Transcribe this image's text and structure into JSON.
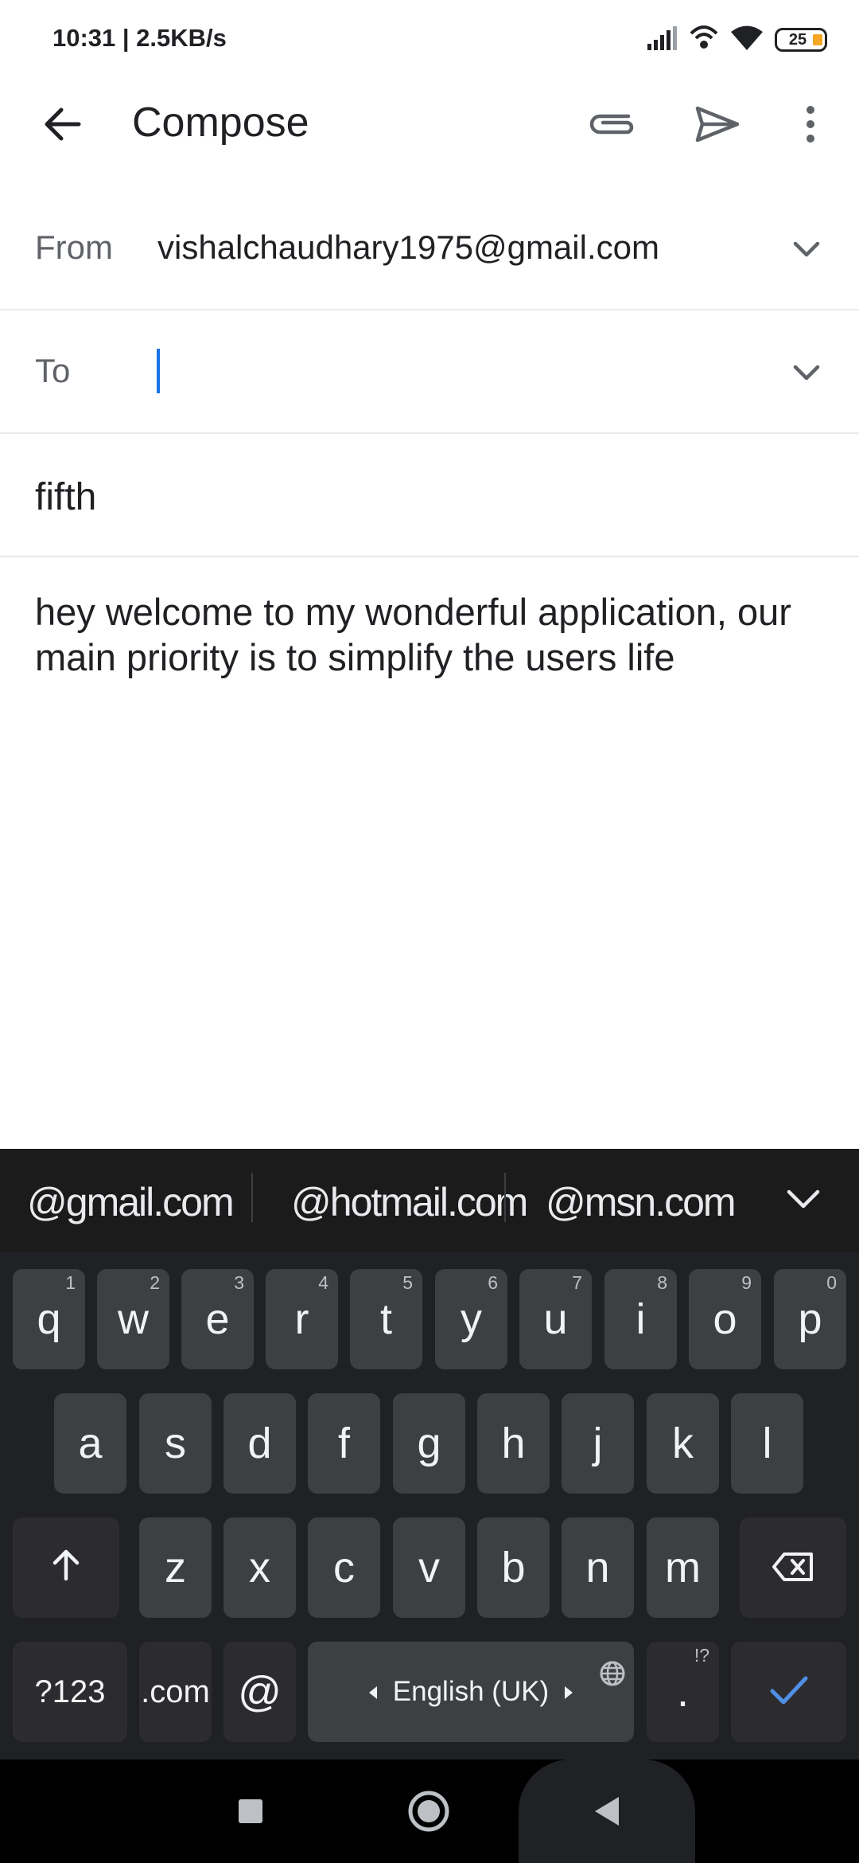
{
  "status_bar": {
    "time": "10:31 | 2.5KB/s",
    "battery": "25",
    "icons": [
      "signal-icon",
      "hotspot-icon",
      "wifi-icon",
      "battery-icon"
    ]
  },
  "app_bar": {
    "title": "Compose",
    "icons": [
      "back-arrow-icon",
      "paperclip-icon",
      "send-icon",
      "more-vert-icon"
    ]
  },
  "form": {
    "from_label": "From",
    "from_value": "vishalchaudhary1975@gmail.com",
    "to_label": "To",
    "to_value": "",
    "subject": "fifth",
    "body": "hey welcome to my wonderful application, our main priority is to simplify the users life"
  },
  "keyboard": {
    "suggestions": [
      "@gmail.com",
      "@hotmail.com",
      "@msn.com"
    ],
    "row1": [
      {
        "key": "q",
        "hint": "1"
      },
      {
        "key": "w",
        "hint": "2"
      },
      {
        "key": "e",
        "hint": "3"
      },
      {
        "key": "r",
        "hint": "4"
      },
      {
        "key": "t",
        "hint": "5"
      },
      {
        "key": "y",
        "hint": "6"
      },
      {
        "key": "u",
        "hint": "7"
      },
      {
        "key": "i",
        "hint": "8"
      },
      {
        "key": "o",
        "hint": "9"
      },
      {
        "key": "p",
        "hint": "0"
      }
    ],
    "row2": [
      "a",
      "s",
      "d",
      "f",
      "g",
      "h",
      "j",
      "k",
      "l"
    ],
    "row3": [
      "z",
      "x",
      "c",
      "v",
      "b",
      "n",
      "m"
    ],
    "symbols_key": "?123",
    "dotcom_key": ".com",
    "at_key": "@",
    "space_label": "English (UK)",
    "period_key": ".",
    "period_hint": "!?",
    "accent_color": "#8ab4f8"
  },
  "nav_bar": {
    "icons": [
      "recents-square-icon",
      "home-circle-icon",
      "back-triangle-icon"
    ]
  }
}
